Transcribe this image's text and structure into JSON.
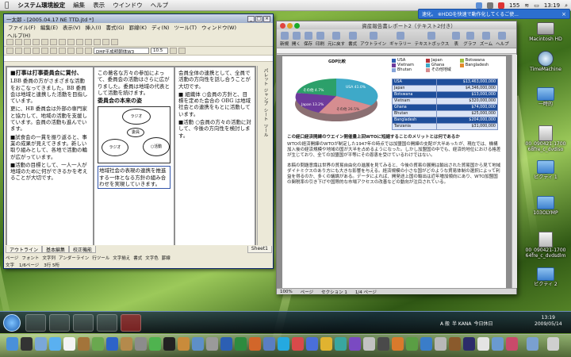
{
  "menubar": {
    "apple": "",
    "app": "システム環境設定",
    "items": [
      "編集",
      "表示",
      "ウインドウ",
      "ヘルプ"
    ],
    "right": {
      "volume_badge": "155",
      "time": "13:19"
    }
  },
  "notification": {
    "text": "速化。 ※HDDを快速で動作化してくるご使..."
  },
  "desktop_icons": [
    {
      "label": "Macintosh HD"
    },
    {
      "label": "TimeMachine"
    },
    {
      "label": "一時的"
    },
    {
      "label": "00_090421-1700\n68fre_c_dvdiso"
    },
    {
      "label": "ビクティ 1"
    },
    {
      "label": "103OLYMP"
    },
    {
      "label": "00_090421-1700\n64fre_c_dvdsdlm"
    },
    {
      "label": "ビクティ 2"
    }
  ],
  "ichitaro": {
    "title": "一太郎 - [2005.04.17 NE TTD.jtd *]",
    "menu": [
      "ファイル(F)",
      "編集(E)",
      "表示(V)",
      "挿入(I)",
      "書式(G)",
      "罫線(K)",
      "ディ(N)",
      "ツール(T)",
      "ウィンドウ(W)"
    ],
    "menu2": "ヘルプ(H)",
    "font_box": "DHP平成明朝体W3",
    "size_box": "10.5",
    "pages": [
      {
        "heading": "■打事は打事委員会に賃付、",
        "paragraphs": [
          "LBB 委員の方がさまざまな活動をおこなってきました。BB 委員会は地域と連携した活動を目指しています。",
          "更に、HB 委員会は外部の専門家と協力して、地域の活動を支援しています。会員の活動も進んでいます。",
          "■試食会の一貫を振り返ると、事業の成果が見えてきます。新しい取り組みとして、各地で活動の輪が広がっています。",
          "■活動の目標として、一人一人が地域のために何ができるかを考えることが大切です。"
        ]
      },
      {
        "heading": "",
        "paragraphs": [
          "この著名な方々の参加によって、委員会の活動はさらに広がりました。委員は地域の代表として活動を続けます。"
        ],
        "subheading": "委員会の本来の姿",
        "diagram_labels": [
          "ラジオ",
          "ラジオ",
          "○活動",
          "委員"
        ],
        "footer": "地域社会の表現の連携を推進する一体となる方針の組み合わせを実現していきます。"
      },
      {
        "heading": "",
        "paragraphs": [
          "会員全体の連携として、全員で活動の方向性を話し合うことが大切です。",
          "■ 組織体 ○会員の方針と、目標を定めた会合の OBG は地域社会との連携をもとに活動しています。",
          "■活動 ○会員の方々の活動に対して、今後の方向性を検討します。"
        ]
      }
    ],
    "side_panel": [
      "パレット",
      "ジャンプ",
      "シート",
      "ツール"
    ],
    "tabs": [
      "アウトライン",
      "基本編集",
      "校正機能"
    ],
    "bottom_tools": [
      "ページ",
      "フォント",
      "文字列",
      "アンダーライン",
      "行ツール",
      "文字揃え",
      "書式",
      "文字色",
      "罫線"
    ],
    "status": [
      "文字",
      "1/6ページ",
      "3行 5桁"
    ],
    "sheet_tab": "Sheet1"
  },
  "word": {
    "title": "資産報告書レポート2（テキスト2付き）",
    "tools": [
      "新規",
      "開く",
      "保存",
      "印刷",
      "元に戻す",
      "書式",
      "アウトライン",
      "ギャラリー",
      "テキストボックス",
      "表",
      "グラフ",
      "ズーム",
      "ヘルプ"
    ],
    "chart_title": "GDP比較",
    "legend": [
      {
        "name": "USA",
        "color": "#2f5eb3"
      },
      {
        "name": "Japan",
        "color": "#b5343b"
      },
      {
        "name": "Botswana",
        "color": "#9fbf3a"
      },
      {
        "name": "Vietnam",
        "color": "#6d3a9c"
      },
      {
        "name": "Ghana",
        "color": "#3ea9c8"
      },
      {
        "name": "Bangladesh",
        "color": "#e28a2c"
      },
      {
        "name": "Bhutan",
        "color": "#86a3d8"
      },
      {
        "name": "その他地域",
        "color": "#d68d90"
      }
    ],
    "table": [
      [
        "USA",
        "$13,463,000,000"
      ],
      [
        "Japan",
        "$4,346,000,000"
      ],
      [
        "Botswana",
        "$13,000,000"
      ],
      [
        "Vietnam",
        "$320,000,000"
      ],
      [
        "Ghana",
        "$74,000,000"
      ],
      [
        "Bhutan",
        "$25,000,000"
      ],
      [
        "Bangladesh",
        "$204,000,000"
      ],
      [
        "Tanzania",
        "$31,000,000"
      ]
    ],
    "pie_labels": [
      "USA 41.0%",
      "Japan 13.2%",
      "その他 4.7%",
      "その他 26.5%"
    ],
    "headline": "この経口経済開練のウエイン開催量上回WTOに短縮することのメリットとは何であるか",
    "paragraph1": "WTOの経済開練のWTOが制定した1947年の時点では加盟国の開練の支配が大半あったが、現在では、機構加入後の経済規模や地域の国が大半を占めるようになった。しかし加盟国の中でも、経済的地位における格差が生じており、全ての加盟国が平等にその恩恵を受けているわけではない。",
    "paragraph2": "本稿の問題意識は世界の貿易自由化の進展を見てみると、今後の貿易の展開は輸出された貿易国から見て地域ダイナミクスのあり方にも大きな影響を与える。経済規模の小さな国がどのような貿易体制の選択によって利益を得るのか、多くの議論がある。データによれば、開発途上国の輸出は近年増加傾向にあり、WTO加盟国の関税率の引き下げや国際的な市場アクセスの改善などの動向が注目されている。",
    "status": [
      "ページ",
      "セクション 1",
      "1/4 ページ"
    ],
    "zoom": "100%"
  },
  "taskbar": {
    "tray_text": "A 般",
    "ime": "半 KANA",
    "clock_time": "13:19",
    "clock_date": "2009/05/14",
    "tray_label": "今日休日"
  }
}
